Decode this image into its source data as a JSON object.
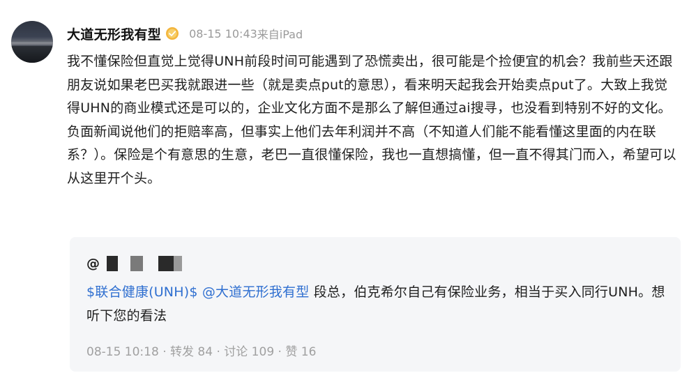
{
  "post": {
    "author": "大道无形我有型",
    "date": "08-15 10:43",
    "source": "来自iPad",
    "content": "我不懂保险但直觉上觉得UNH前段时间可能遇到了恐慌卖出，很可能是个捡便宜的机会？我前些天还跟朋友说如果老巴买我就跟进一些（就是卖点put的意思），看来明天起我会开始卖点put了。大致上我觉得UHN的商业模式还是可以的，企业文化方面不是那么了解但通过ai搜寻，也没看到特别不好的文化。负面新闻说他们的拒赔率高，但事实上他们去年利润并不高（不知道人们能不能看懂这里面的内在联系？）。保险是个有意思的生意，老巴一直很懂保险，我也一直想搞懂，但一直不得其门而入，希望可以从这里开个头。"
  },
  "quoted": {
    "at_symbol": "@",
    "stock_tag": "$联合健康(UNH)$",
    "mention": "@大道无形我有型",
    "text": "段总，伯克希尔自己有保险业务，相当于买入同行UNH。想听下您的看法",
    "date": "08-15 10:18",
    "separator": "·",
    "repost": "转发 84",
    "comment": "讨论 109",
    "like": "赞 16"
  },
  "colors": {
    "link": "#2f6fd0",
    "meta": "#9a9a9a",
    "quote_bg": "#f5f6f8"
  },
  "icons": {
    "badge": "verified-badge-icon"
  }
}
